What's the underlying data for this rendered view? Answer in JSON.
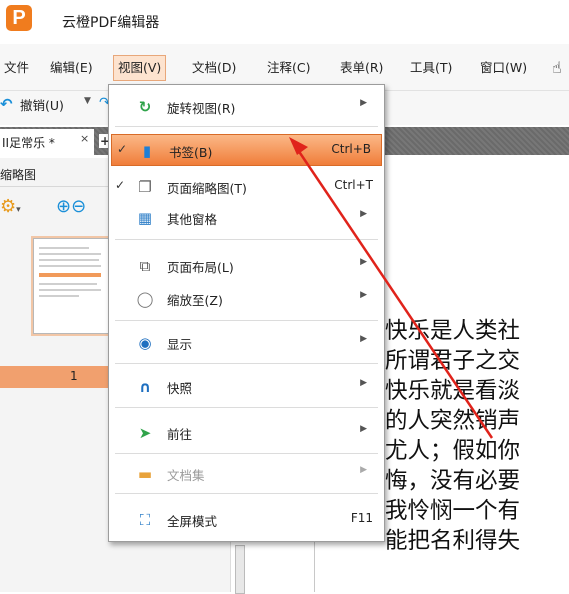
{
  "app": {
    "logo_letter": "P",
    "title": "云橙PDF编辑器",
    "accent": "#f07c1e"
  },
  "menubar": {
    "items": [
      {
        "label": "文件"
      },
      {
        "label": "编辑(E)"
      },
      {
        "label": "视图(V)"
      },
      {
        "label": "文档(D)"
      },
      {
        "label": "注释(C)"
      },
      {
        "label": "表单(R)"
      },
      {
        "label": "工具(T)"
      },
      {
        "label": "窗口(W)"
      }
    ]
  },
  "toolbar": {
    "undo_label": "撤销(U)"
  },
  "tabs": {
    "doc_tab_label": "II足常乐 *",
    "close": "×",
    "new_tab": "+"
  },
  "panel": {
    "title": "缩略图",
    "page_number": "1"
  },
  "document": {
    "lines": [
      "快乐是人类社",
      "所谓君子之交",
      "快乐就是看淡",
      "的人突然销声",
      "尤人；假如你",
      "悔，没有必要",
      "我怜悯一个有",
      "能把名利得失"
    ]
  },
  "view_menu": {
    "items": [
      {
        "label": "旋转视图(R)",
        "icon": "rotate-icon",
        "submenu": true
      },
      {
        "label": "书签(B)",
        "icon": "bookmark-icon",
        "shortcut": "Ctrl+B",
        "checked": true,
        "highlighted": true
      },
      {
        "label": "页面缩略图(T)",
        "icon": "page-thumbnails-icon",
        "shortcut": "Ctrl+T",
        "checked": true
      },
      {
        "label": "其他窗格",
        "icon": "panes-icon",
        "submenu": true
      },
      {
        "label": "页面布局(L)",
        "icon": "page-layout-icon",
        "submenu": true
      },
      {
        "label": "缩放至(Z)",
        "icon": "zoom-icon",
        "submenu": true
      },
      {
        "label": "显示",
        "icon": "display-icon",
        "submenu": true
      },
      {
        "label": "快照",
        "icon": "snapshot-icon",
        "submenu": true
      },
      {
        "label": "前往",
        "icon": "goto-icon",
        "submenu": true
      },
      {
        "label": "文档集",
        "icon": "document-set-icon",
        "submenu": true,
        "disabled": true
      },
      {
        "label": "全屏模式",
        "icon": "fullscreen-icon",
        "shortcut": "F11"
      }
    ],
    "highlight_color": "#f07d3a",
    "annotation_arrow_color": "#e0231b"
  }
}
